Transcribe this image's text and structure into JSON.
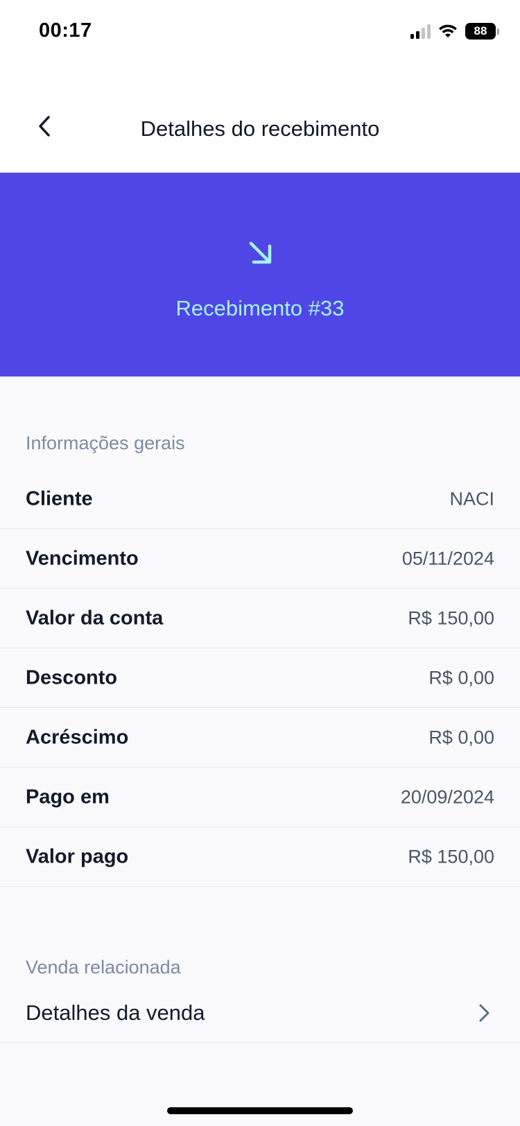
{
  "status_bar": {
    "time": "00:17",
    "battery": "88",
    "icons": [
      "signal-icon",
      "wifi-icon",
      "battery-icon"
    ]
  },
  "header": {
    "title": "Detalhes do recebimento",
    "back_icon": "chevron-left-icon"
  },
  "hero": {
    "icon": "arrow-down-right-icon",
    "title": "Recebimento #33",
    "background": "#4f46e5",
    "accent": "#a5f3fc"
  },
  "general_info": {
    "label": "Informações gerais",
    "rows": [
      {
        "key": "Cliente",
        "value": "NACI"
      },
      {
        "key": "Vencimento",
        "value": "05/11/2024"
      },
      {
        "key": "Valor da conta",
        "value": "R$ 150,00"
      },
      {
        "key": "Desconto",
        "value": "R$ 0,00"
      },
      {
        "key": "Acréscimo",
        "value": "R$ 0,00"
      },
      {
        "key": "Pago em",
        "value": "20/09/2024"
      },
      {
        "key": "Valor pago",
        "value": "R$ 150,00"
      }
    ]
  },
  "related_sale": {
    "label": "Venda relacionada",
    "link_label": "Detalhes da venda",
    "link_icon": "chevron-right-icon"
  }
}
